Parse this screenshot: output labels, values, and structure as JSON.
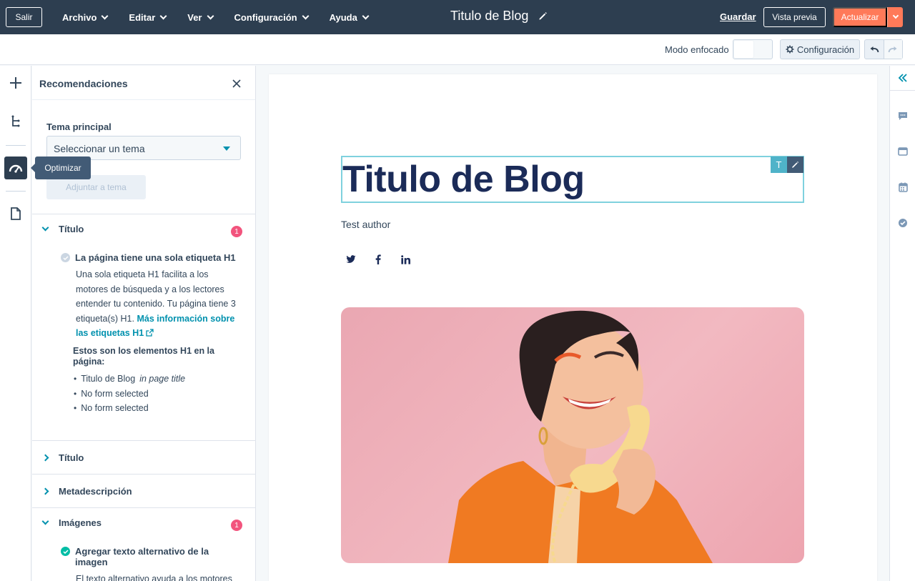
{
  "topbar": {
    "exit_label": "Salir",
    "menu": [
      {
        "label": "Archivo"
      },
      {
        "label": "Editar"
      },
      {
        "label": "Ver"
      },
      {
        "label": "Configuración"
      },
      {
        "label": "Ayuda"
      }
    ],
    "document_title": "Titulo de Blog",
    "save_label": "Guardar",
    "preview_label": "Vista previa",
    "update_label": "Actualizar"
  },
  "subbar": {
    "focus_mode_label": "Modo enfocado",
    "focus_mode_on": false,
    "settings_label": "Configuración"
  },
  "rail": {
    "tooltip": "Optimizar",
    "icons": [
      "plus-icon",
      "tree-icon",
      "speedometer-icon",
      "document-icon"
    ]
  },
  "panel": {
    "title": "Recomendaciones",
    "topic_label": "Tema principal",
    "topic_select_value": "Seleccionar un tema",
    "attach_button": "Adjuntar a tema",
    "sections": [
      {
        "title": "Título",
        "expanded": true,
        "badge": "1",
        "check": {
          "title": "La página tiene una sola etiqueta H1",
          "body_lines": [
            "Una sola etiqueta H1 facilita a los",
            "motores de búsqueda y a los lectores",
            "entender tu contenido. Tu página tiene 3",
            "etiqueta(s) H1."
          ],
          "link_text_1": "Más información sobre",
          "link_text_2": "las etiquetas H1",
          "h1_list_label": "Estos son los elementos H1 en la página:",
          "h1_items": [
            {
              "text": "Titulo de Blog",
              "note": "in page title"
            },
            {
              "text": "No form selected",
              "note": ""
            },
            {
              "text": "No form selected",
              "note": ""
            }
          ]
        }
      },
      {
        "title": "Título",
        "expanded": false
      },
      {
        "title": "Metadescripción",
        "expanded": false
      },
      {
        "title": "Imágenes",
        "expanded": true,
        "badge": "1",
        "check": {
          "title": "Agregar texto alternativo de la imagen",
          "body_first_line": "El texto alternativo ayuda a los motores"
        }
      }
    ]
  },
  "canvas": {
    "heading": "Titulo de Blog",
    "heading_tool_label": "T",
    "author": "Test author",
    "social_icons": [
      "twitter-icon",
      "facebook-icon",
      "linkedin-icon"
    ]
  },
  "colors": {
    "topbar": "#2d3e50",
    "accent_orange": "#ff7a59",
    "link_teal": "#0091ae",
    "badge_pink": "#f2547d",
    "heading_navy": "#1b2b58",
    "success_green": "#00bda5"
  }
}
